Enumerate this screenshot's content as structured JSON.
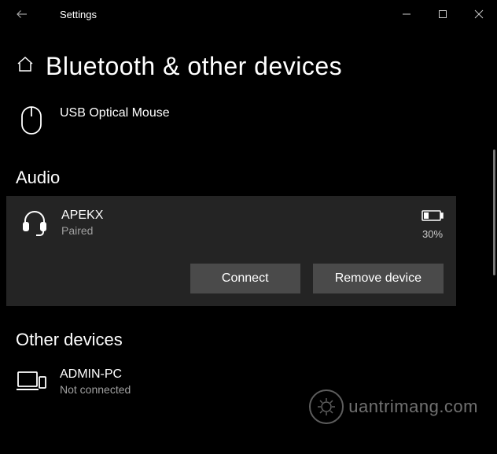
{
  "window": {
    "title": "Settings"
  },
  "page": {
    "heading": "Bluetooth & other devices"
  },
  "mouse_devices": [
    {
      "name": "USB Optical Mouse"
    }
  ],
  "sections": {
    "audio_title": "Audio",
    "other_title": "Other devices"
  },
  "audio_device": {
    "name": "APEKX",
    "status": "Paired",
    "battery_pct": "30%",
    "actions": {
      "connect": "Connect",
      "remove": "Remove device"
    }
  },
  "other_device": {
    "name": "ADMIN-PC",
    "status": "Not connected"
  },
  "watermark": {
    "text": "uantrimang.com"
  }
}
